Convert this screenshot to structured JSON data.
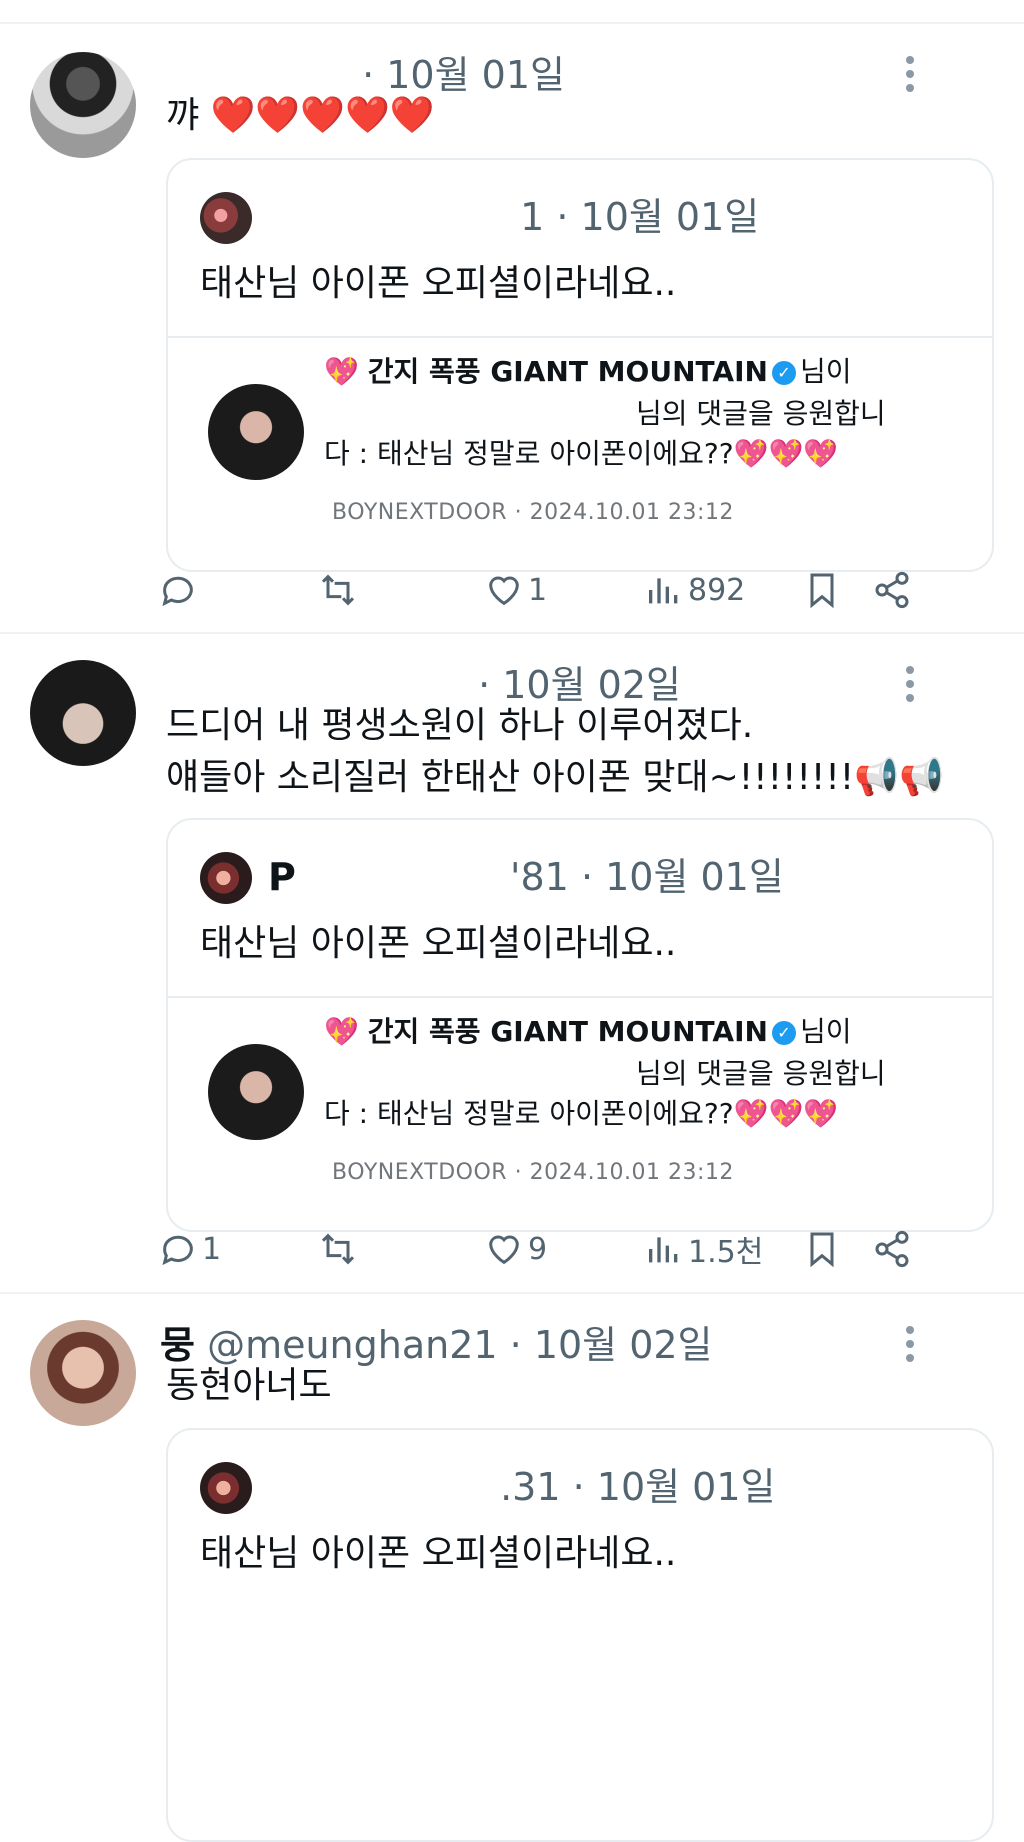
{
  "posts": [
    {
      "author_name": "",
      "handle": "",
      "date": "· 10월 01일",
      "text_lines": [
        "꺄 ❤️❤️❤️❤️❤️"
      ],
      "quote": {
        "author_name": "",
        "handle_tail": "1",
        "date": "· 10월 01일",
        "text": "태산님 아이폰 오피셜이라네요..",
        "notice_line1_title": "간지 폭풍 GIANT MOUNTAIN",
        "notice_line1_suffix": "님이",
        "notice_line2": "님의 댓글을 응원합니",
        "notice_line3": "다 : 태산님 정말로 아이폰이에요??",
        "notice_footer": "BOYNEXTDOOR · 2024.10.01 23:12"
      },
      "actions": {
        "replies": "",
        "reposts": "",
        "likes": "1",
        "views": "892"
      }
    },
    {
      "author_name": "",
      "handle": "",
      "date": "· 10월 02일",
      "text_lines": [
        "드디어 내 평생소원이 하나 이루어졌다.",
        "얘들아 소리질러 한태산 아이폰 맞대~!!!!!!!!📢📢"
      ],
      "quote": {
        "author_name": "P",
        "handle_tail": "'81",
        "date": "· 10월 01일",
        "text": "태산님 아이폰 오피셜이라네요..",
        "notice_line1_title": "간지 폭풍 GIANT MOUNTAIN",
        "notice_line1_suffix": "님이",
        "notice_line2": "님의 댓글을 응원합니",
        "notice_line3": "다 : 태산님 정말로 아이폰이에요??",
        "notice_footer": "BOYNEXTDOOR · 2024.10.01 23:12"
      },
      "actions": {
        "replies": "1",
        "reposts": "",
        "likes": "9",
        "views": "1.5천"
      }
    },
    {
      "author_name": "뭉",
      "handle": "@meunghan21",
      "date": "· 10월 02일",
      "text_lines": [
        "동현아너도"
      ],
      "quote": {
        "author_name": "",
        "handle_tail": ".31",
        "date": "· 10월 01일",
        "text": "태산님 아이폰 오피셜이라네요.."
      }
    }
  ],
  "icons": {
    "reply": "reply-icon",
    "repost": "repost-icon",
    "like": "heart-icon",
    "views": "views-icon",
    "bookmark": "bookmark-icon",
    "share": "share-icon",
    "more": "more-icon"
  },
  "colors": {
    "text": "#0f1419",
    "muted": "#536471",
    "verified": "#1d9bf0",
    "heart_emoji": "#f7417a",
    "sparkle_heart": "#ff5da2"
  }
}
